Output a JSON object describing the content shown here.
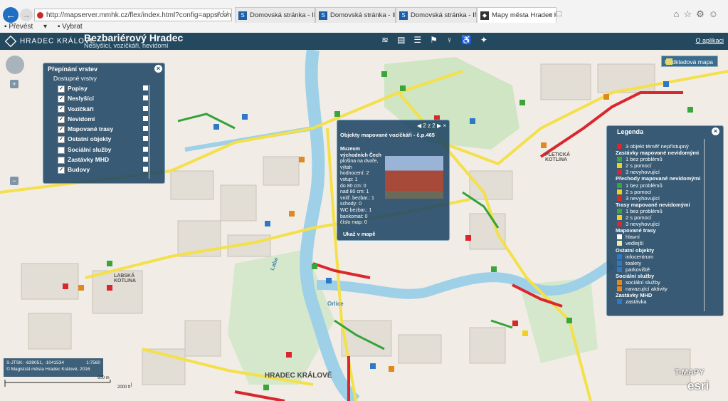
{
  "browser": {
    "address": "http://mapserver.mmhk.cz/flex/index.html?config=apps/config-mmhk-bariery.x",
    "favorites": [
      "Převést",
      "Vybrat"
    ],
    "tabs": [
      {
        "label": "Domovská stránka - INTRANET",
        "active": false
      },
      {
        "label": "Domovská stránka - INTRANET",
        "active": false
      },
      {
        "label": "Domovská stránka - INTRANET",
        "active": false
      },
      {
        "label": "Mapy města Hradec Králové",
        "active": true
      }
    ]
  },
  "app": {
    "logo_text": "HRADEC KRÁLOVÉ",
    "title": "Bezbariérový Hradec",
    "subtitle": "Neslyšící, vozíčkáři, nevidomí",
    "about": "O aplikaci",
    "accent": "#24495f"
  },
  "layers": {
    "title": "Přepínání vrstev",
    "subtitle": "Dostupné vrstvy",
    "items": [
      "Popisy",
      "Neslyšící",
      "Vozíčkáři",
      "Nevidomí",
      "Mapované trasy",
      "Ostatní objekty",
      "Sociální služby",
      "Zastávky MHD",
      "Budovy"
    ]
  },
  "popup": {
    "counter": "2 z 2",
    "title": "Objekty mapované vozíčkáři - č.p.465",
    "name": "Muzeum východních Čech",
    "lines": [
      "plošina na dvoře,",
      "výtah",
      "hodnocení: 2",
      "vstup: 1",
      "do 80 cm: 0",
      "nad 80 cm: 1",
      "vnitř. bezbar.: 1",
      "schody: 0",
      "WC bezbar.: 1",
      "bankomat: 0",
      "číslo map: 0"
    ],
    "zoom_link": "Ukaž v mapě"
  },
  "legend": {
    "title": "Legenda",
    "items": [
      {
        "type": "item",
        "label": "3 objekt téměř nepřístupný",
        "color": "#d9272e"
      },
      {
        "type": "head",
        "label": "Zastávky mapované nevidomými"
      },
      {
        "type": "item",
        "label": "1 bez problémů",
        "color": "#3aa53a"
      },
      {
        "type": "item",
        "label": "2 s pomocí",
        "color": "#f0d020"
      },
      {
        "type": "item",
        "label": "3 nevyhovující",
        "color": "#d9272e"
      },
      {
        "type": "head",
        "label": "Přechody mapované nevidomými"
      },
      {
        "type": "item",
        "label": "1 bez problémů",
        "color": "#3aa53a"
      },
      {
        "type": "item",
        "label": "2 s pomocí",
        "color": "#f0d020"
      },
      {
        "type": "item",
        "label": "3 nevyhovující",
        "color": "#d9272e"
      },
      {
        "type": "head",
        "label": "Trasy mapované nevidomými"
      },
      {
        "type": "item",
        "label": "1 bez problémů",
        "color": "#3aa53a"
      },
      {
        "type": "item",
        "label": "2 s pomocí",
        "color": "#f0d020"
      },
      {
        "type": "item",
        "label": "3 nevyhovující",
        "color": "#d9272e"
      },
      {
        "type": "head",
        "label": "Mapované trasy"
      },
      {
        "type": "item",
        "label": "hlavní",
        "color": "#ffffff"
      },
      {
        "type": "item",
        "label": "vedlejší",
        "color": "#f5f0a0"
      },
      {
        "type": "head",
        "label": "Ostatní objekty"
      },
      {
        "type": "item",
        "label": "infocentrum",
        "color": "#2e78c8"
      },
      {
        "type": "item",
        "label": "toalety",
        "color": "#2e78c8"
      },
      {
        "type": "item",
        "label": "parkoviště",
        "color": "#2e78c8"
      },
      {
        "type": "head",
        "label": "Sociální služby"
      },
      {
        "type": "item",
        "label": "sociální služby",
        "color": "#e08a1e"
      },
      {
        "type": "item",
        "label": "navazující aktivity",
        "color": "#e08a1e"
      },
      {
        "type": "head",
        "label": "Zastávky MHD"
      },
      {
        "type": "item",
        "label": "zastávka",
        "color": "#2e78c8"
      }
    ]
  },
  "map": {
    "basemap_button": "Podkladová mapa",
    "coords": "S-JTSK: -639051, -1041534",
    "zoom": "1:7560",
    "copyright": "© Magistrát města Hradec Králové, 2016",
    "scale_m": "500 m",
    "scale_ft": "2000 ft",
    "brand_tmapy": "T-MAPY",
    "brand_esri": "esri",
    "labels": [
      "HRADEC KRÁLOVÉ",
      "LABSKÁ KOTLINA",
      "PLETICKÁ KOTLINA",
      "Labe",
      "Orlice"
    ]
  }
}
